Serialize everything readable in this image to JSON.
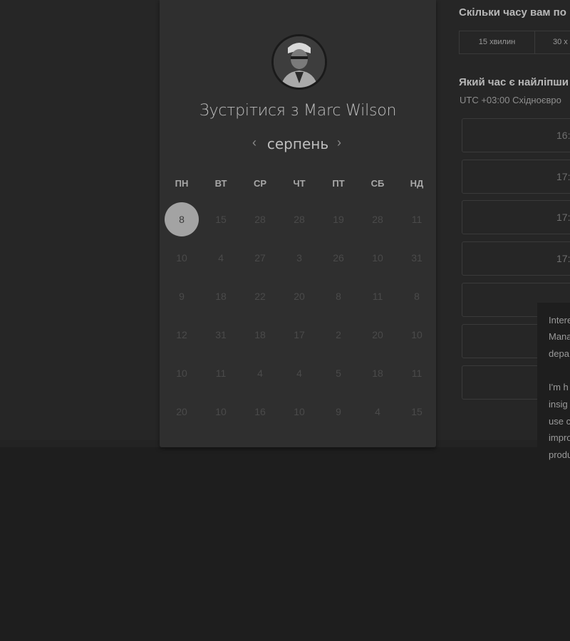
{
  "meeting": {
    "title": "Зустрітися з Marc Wilson",
    "month": "серпень",
    "prev_arrow": "‹",
    "next_arrow": "›"
  },
  "weekdays": [
    "ПН",
    "ВТ",
    "СР",
    "ЧТ",
    "ПТ",
    "СБ",
    "НД"
  ],
  "calendar": {
    "weeks": [
      [
        "8",
        "15",
        "28",
        "28",
        "19",
        "28",
        "11"
      ],
      [
        "10",
        "4",
        "27",
        "3",
        "26",
        "10",
        "31"
      ],
      [
        "9",
        "18",
        "22",
        "20",
        "8",
        "11",
        "8"
      ],
      [
        "12",
        "31",
        "18",
        "17",
        "2",
        "20",
        "10"
      ],
      [
        "10",
        "11",
        "4",
        "4",
        "5",
        "18",
        "11"
      ],
      [
        "20",
        "10",
        "16",
        "10",
        "9",
        "4",
        "15"
      ]
    ],
    "selected_day": "8"
  },
  "duration": {
    "heading": "Скільки часу вам по",
    "options": [
      "15 хвилин",
      "30 х"
    ]
  },
  "times": {
    "heading": "Який час є найліпши",
    "timezone": "UTC +03:00 Східноєвро",
    "slots": [
      "16:",
      "17:",
      "17:",
      "17:",
      "",
      "",
      ""
    ]
  },
  "popup": {
    "lines": [
      "Intere",
      "Mana",
      "depa",
      "",
      "I'm h",
      "insig",
      "use c",
      "impro",
      "produ"
    ]
  },
  "colors": {
    "background": "#1e1e1e",
    "card": "#2f2f2f",
    "selected_day": "#a3a3a3"
  }
}
